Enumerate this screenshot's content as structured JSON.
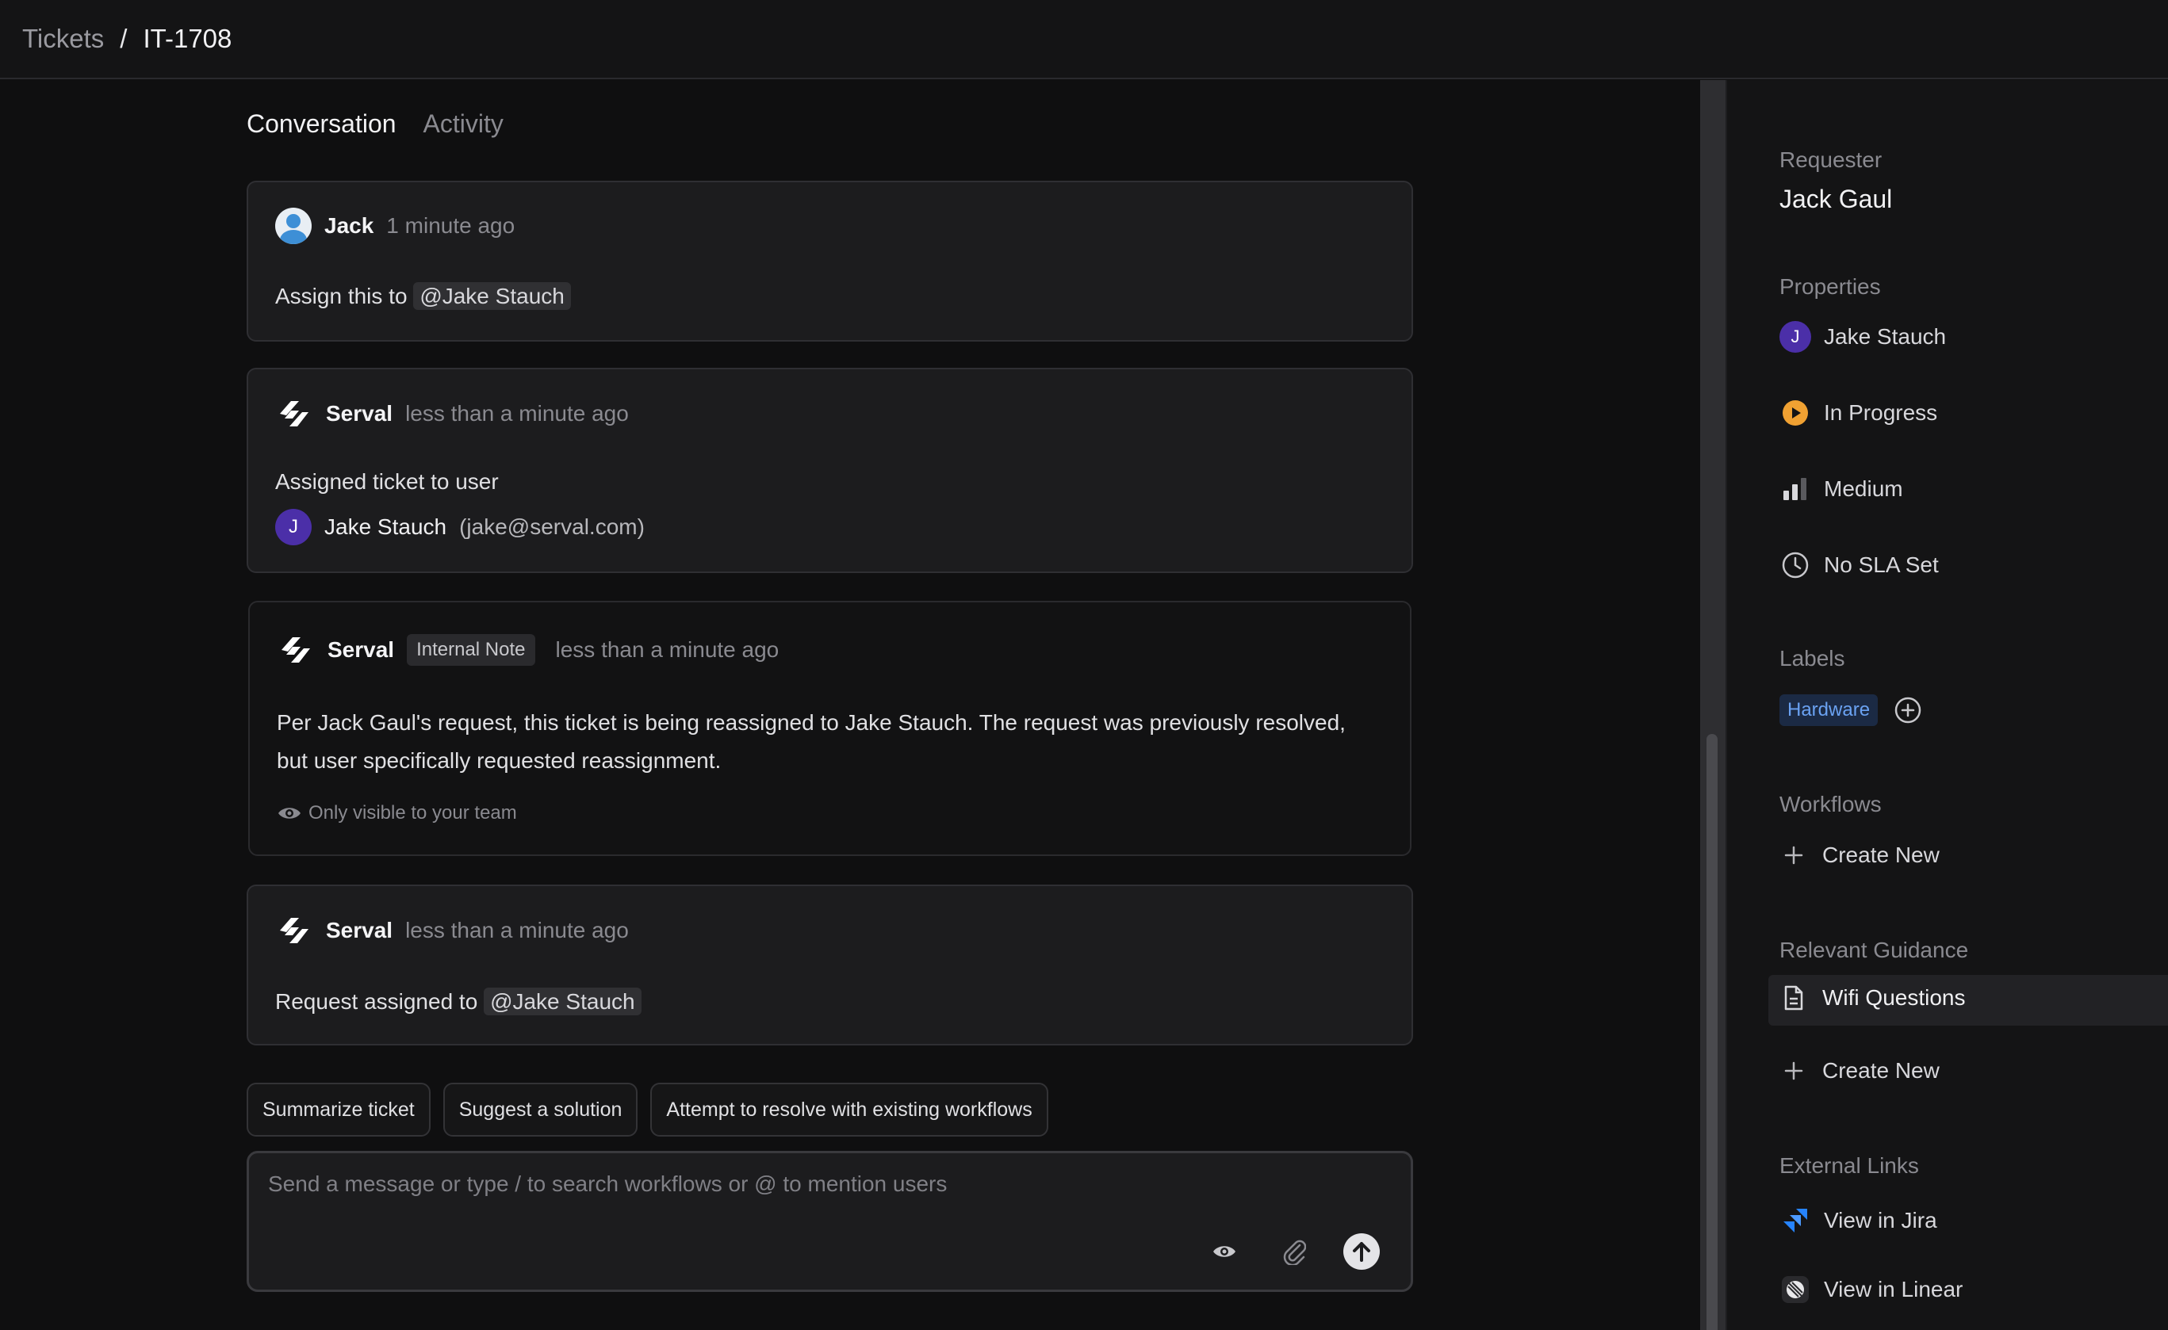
{
  "breadcrumb": {
    "root": "Tickets",
    "separator": "/",
    "current": "IT-1708"
  },
  "tabs": [
    {
      "label": "Conversation"
    },
    {
      "label": "Activity"
    }
  ],
  "messages": [
    {
      "author": "Jack",
      "time": "1 minute ago",
      "text_prefix": "Assign this to",
      "mention": "@Jake Stauch"
    },
    {
      "author": "Serval",
      "time": "less than a minute ago",
      "text": "Assigned ticket to user",
      "assignee_initial": "J",
      "assignee_name": "Jake Stauch",
      "assignee_email": "(jake@serval.com)"
    },
    {
      "author": "Serval",
      "badge": "Internal Note",
      "time": "less than a minute ago",
      "text_line1": "Per Jack Gaul's request, this ticket is being reassigned to Jake Stauch. The request was previously resolved,",
      "text_line2": "but user specifically requested reassignment.",
      "visibility": "Only visible to your team"
    },
    {
      "author": "Serval",
      "time": "less than a minute ago",
      "text_prefix": "Request assigned to",
      "mention": "@Jake Stauch"
    }
  ],
  "quick_actions": [
    "Summarize ticket",
    "Suggest a solution",
    "Attempt to resolve with existing workflows"
  ],
  "composer": {
    "placeholder": "Send a message or type / to search workflows or @ to mention users"
  },
  "sidebar": {
    "requester_label": "Requester",
    "requester_name": "Jack Gaul",
    "properties_label": "Properties",
    "assignee_initial": "J",
    "assignee": "Jake Stauch",
    "status": "In Progress",
    "priority": "Medium",
    "sla": "No SLA Set",
    "labels_label": "Labels",
    "label_tag": "Hardware",
    "workflows_label": "Workflows",
    "workflows_create": "Create New",
    "guidance_label": "Relevant Guidance",
    "guidance_item": "Wifi Questions",
    "guidance_create": "Create New",
    "external_label": "External Links",
    "jira_link": "View in Jira",
    "linear_link": "View in Linear"
  },
  "colors": {
    "status_in_progress": "#f0a132",
    "label_blue": "#6aa2f2",
    "avatar_purple": "#4b2fa8",
    "jira_blue": "#2684ff"
  }
}
